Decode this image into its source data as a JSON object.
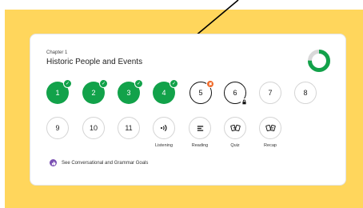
{
  "chapter": {
    "label": "Chapter 1",
    "title": "Historic People and Events",
    "progress_fraction": 0.75
  },
  "lessons": [
    {
      "label": "1",
      "status": "completed"
    },
    {
      "label": "2",
      "status": "completed"
    },
    {
      "label": "3",
      "status": "completed"
    },
    {
      "label": "4",
      "status": "completed"
    },
    {
      "label": "5",
      "status": "current-flagged"
    },
    {
      "label": "6",
      "status": "current-locked"
    },
    {
      "label": "7",
      "status": "todo"
    },
    {
      "label": "8",
      "status": "todo"
    },
    {
      "label": "9",
      "status": "todo"
    },
    {
      "label": "10",
      "status": "todo"
    },
    {
      "label": "11",
      "status": "todo"
    }
  ],
  "activities": [
    {
      "label": "Listening",
      "icon": "listening-icon"
    },
    {
      "label": "Reading",
      "icon": "reading-icon"
    },
    {
      "label": "Quiz",
      "icon": "quiz-cards-icon"
    },
    {
      "label": "Recap",
      "icon": "recap-cards-icon"
    }
  ],
  "goals_link": "See Conversational and Grammar Goals",
  "colors": {
    "background": "#ffd65c",
    "completed": "#12a24a",
    "flag": "#f06a2a",
    "goals_icon": "#7a4fb3",
    "progress_track": "#d9d9d9"
  }
}
